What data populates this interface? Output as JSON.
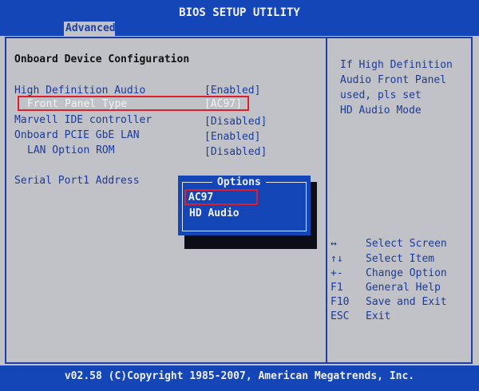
{
  "header": {
    "title": "BIOS SETUP UTILITY",
    "tab": "Advanced"
  },
  "main": {
    "section_title": "Onboard Device Configuration",
    "items": [
      {
        "label": "High Definition Audio",
        "value": "[Enabled]"
      },
      {
        "label": "Front Panel Type",
        "value": "[AC97]"
      },
      {
        "label": "Marvell IDE controller",
        "value": "[Disabled]"
      },
      {
        "label": "Onboard PCIE GbE LAN",
        "value": "[Enabled]"
      },
      {
        "label": "LAN Option ROM",
        "value": "[Disabled]"
      },
      {
        "label": "Serial Port1 Address",
        "value": ""
      }
    ]
  },
  "popup": {
    "title": "Options",
    "options": [
      "AC97",
      "HD Audio"
    ]
  },
  "help": {
    "lines": [
      "If High Definition",
      "Audio Front Panel",
      "used, pls set",
      "HD Audio Mode"
    ]
  },
  "keys": [
    {
      "key": "↔",
      "action": "Select Screen"
    },
    {
      "key": "↑↓",
      "action": "Select Item"
    },
    {
      "key": "+-",
      "action": "Change Option"
    },
    {
      "key": "F1",
      "action": "General Help"
    },
    {
      "key": "F10",
      "action": "Save and Exit"
    },
    {
      "key": "ESC",
      "action": "Exit"
    }
  ],
  "footer": {
    "text": "v02.58 (C)Copyright 1985-2007, American Megatrends, Inc."
  },
  "colors": {
    "blue": "#1446b8",
    "text_blue": "#1b3a9a",
    "panel": "#c0c2c8",
    "highlight": "#e01e2a"
  }
}
